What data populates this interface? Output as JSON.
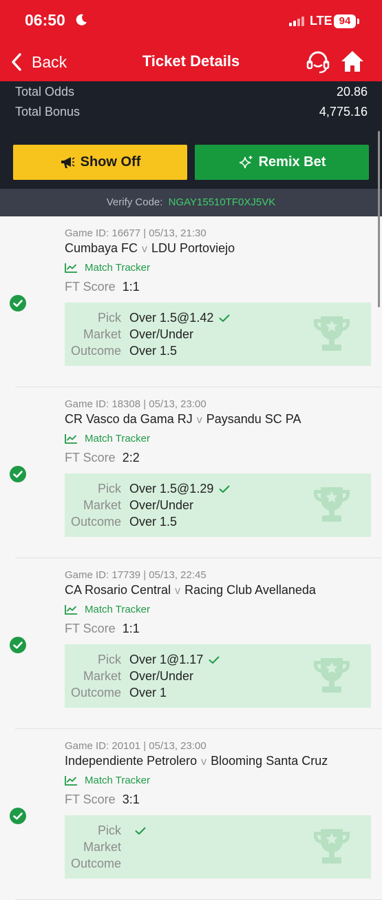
{
  "status_bar": {
    "time": "06:50",
    "network": "LTE",
    "battery": "94"
  },
  "nav": {
    "back_label": "Back",
    "title": "Ticket Details"
  },
  "summary": {
    "total_odds_label": "Total Odds",
    "total_odds_value": "20.86",
    "total_bonus_label": "Total Bonus",
    "total_bonus_value": "4,775.16"
  },
  "actions": {
    "show_off_label": "Show Off",
    "remix_label": "Remix Bet"
  },
  "verify": {
    "label": "Verify Code:",
    "code": "NGAY15510TF0XJ5VK"
  },
  "labels": {
    "tracker": "Match Tracker",
    "ft_score": "FT Score",
    "pick": "Pick",
    "market": "Market",
    "outcome": "Outcome",
    "versus": "v"
  },
  "tickets": [
    {
      "meta": "Game ID: 16677 | 05/13, 21:30",
      "home": "Cumbaya FC",
      "away": "LDU Portoviejo",
      "ft_score": "1:1",
      "pick": "Over 1.5@1.42",
      "market": "Over/Under",
      "outcome": "Over 1.5"
    },
    {
      "meta": "Game ID: 18308 | 05/13, 23:00",
      "home": "CR Vasco da Gama RJ",
      "away": "Paysandu SC PA",
      "ft_score": "2:2",
      "pick": "Over 1.5@1.29",
      "market": "Over/Under",
      "outcome": "Over 1.5"
    },
    {
      "meta": "Game ID: 17739 | 05/13, 22:45",
      "home": "CA Rosario Central",
      "away": "Racing Club Avellaneda",
      "ft_score": "1:1",
      "pick": "Over 1@1.17",
      "market": "Over/Under",
      "outcome": "Over 1"
    },
    {
      "meta": "Game ID: 20101 | 05/13, 23:00",
      "home": "Independiente Petrolero",
      "away": "Blooming Santa Cruz",
      "ft_score": "3:1",
      "pick": "",
      "market": "",
      "outcome": ""
    }
  ],
  "colors": {
    "brand_red": "#e41827",
    "show_off_yellow": "#f7c31d",
    "remix_green": "#179a3e",
    "won_green": "#1f9a47",
    "pick_bg": "#d7f0dd"
  }
}
